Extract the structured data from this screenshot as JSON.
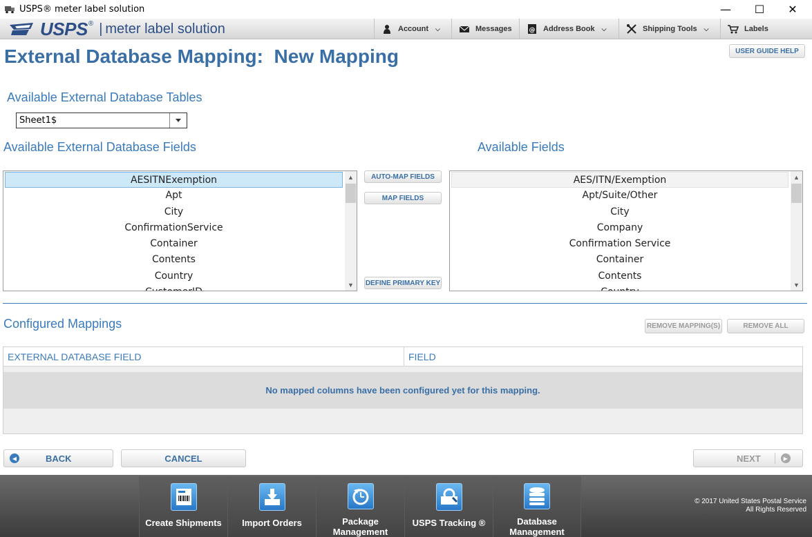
{
  "window": {
    "title": "USPS® meter label solution",
    "minimize": "—",
    "maximize": "☐",
    "close": "✕"
  },
  "header": {
    "logo_text": "USPS",
    "logo_reg": "®",
    "divider": "|",
    "product_name": "meter label solution",
    "nav": [
      {
        "label": "Account",
        "icon": "user-icon",
        "has_dropdown": true
      },
      {
        "label": "Messages",
        "icon": "envelope-icon",
        "has_dropdown": false
      },
      {
        "label": "Address Book",
        "icon": "address-book-icon",
        "has_dropdown": true
      },
      {
        "label": "Shipping Tools",
        "icon": "tools-icon",
        "has_dropdown": true
      },
      {
        "label": "Labels",
        "icon": "cart-icon",
        "has_dropdown": false
      }
    ]
  },
  "page": {
    "title": "External Database Mapping:  New Mapping",
    "user_guide": "USER GUIDE HELP"
  },
  "tables": {
    "label": "Available External Database Tables",
    "selected": "Sheet1$"
  },
  "external_fields": {
    "label": "Available External Database Fields",
    "items": [
      "AESITNExemption",
      "Apt",
      "City",
      "ConfirmationService",
      "Container",
      "Contents",
      "Country",
      "CustomerID"
    ],
    "selected_index": 0
  },
  "available_fields": {
    "label": "Available Fields",
    "items": [
      "AES/ITN/Exemption",
      "Apt/Suite/Other",
      "City",
      "Company",
      "Confirmation Service",
      "Container",
      "Contents",
      "Country"
    ]
  },
  "mapping_buttons": {
    "auto_map": "AUTO-MAP FIELDS",
    "map": "MAP FIELDS",
    "define_key": "DEFINE PRIMARY KEY"
  },
  "configured": {
    "label": "Configured Mappings",
    "remove": "REMOVE MAPPING(S)",
    "remove_all": "REMOVE ALL",
    "columns": [
      "EXTERNAL DATABASE FIELD",
      "FIELD"
    ],
    "empty_message": "No mapped columns have been configured yet for this mapping."
  },
  "footer_nav": {
    "back": "BACK",
    "cancel": "CANCEL",
    "next": "NEXT"
  },
  "dock": [
    {
      "label": "Create Shipments",
      "icon": "create-shipments-icon"
    },
    {
      "label": "Import Orders",
      "icon": "import-orders-icon"
    },
    {
      "label": "Package\nManagement",
      "icon": "package-management-icon"
    },
    {
      "label": "USPS Tracking ®",
      "icon": "usps-tracking-icon"
    },
    {
      "label": "Database\nManagement",
      "icon": "database-management-icon"
    }
  ],
  "copyright": {
    "line1": "© 2017 United States Postal Service",
    "line2": "All Rights Reserved"
  },
  "colors": {
    "accent": "#3a7bbd",
    "title": "#3a6fa6",
    "brand": "#2d4e87",
    "selection": "#cde8f7"
  }
}
